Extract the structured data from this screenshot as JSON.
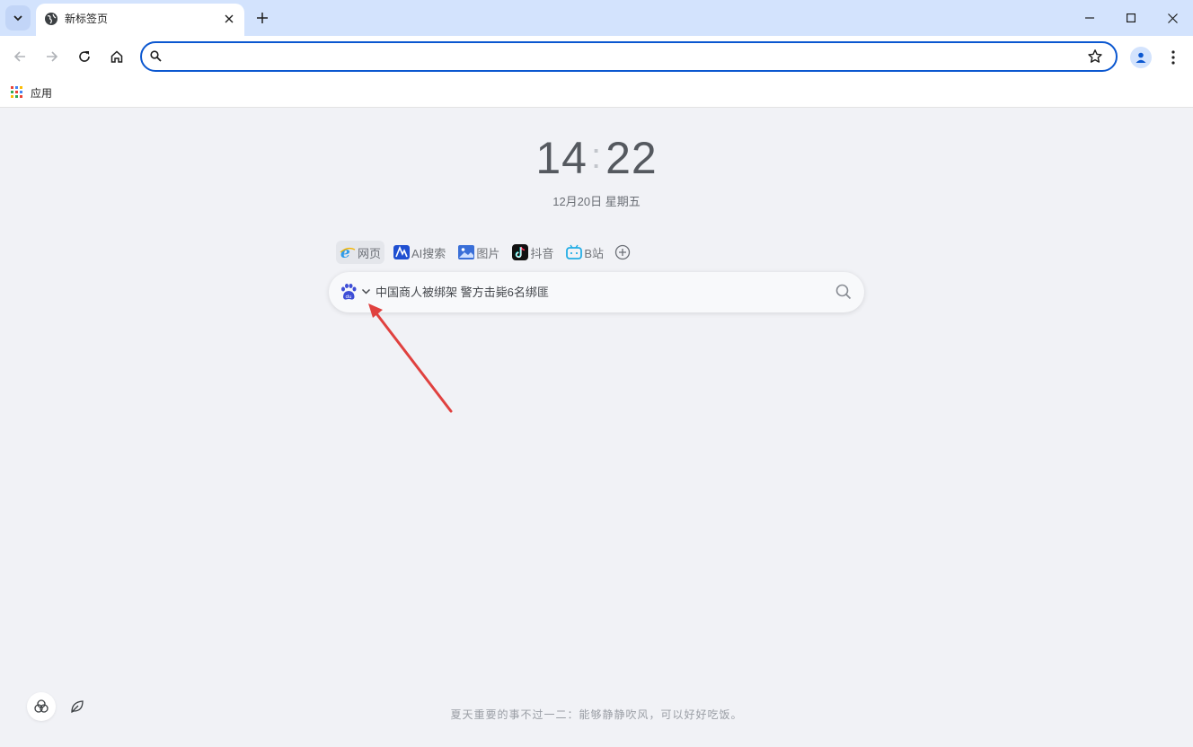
{
  "tab": {
    "title": "新标签页"
  },
  "omnibox": {
    "value": "",
    "placeholder": ""
  },
  "bookmarks": {
    "apps_label": "应用"
  },
  "clock": {
    "hours": "14",
    "separator": ":",
    "minutes": "22"
  },
  "date": {
    "text": "12月20日 星期五"
  },
  "engines": [
    {
      "label": "网页",
      "icon": "ie-icon",
      "active": true
    },
    {
      "label": "AI搜索",
      "icon": "ai-search-icon"
    },
    {
      "label": "图片",
      "icon": "image-icon"
    },
    {
      "label": "抖音",
      "icon": "douyin-icon"
    },
    {
      "label": "B站",
      "icon": "bilibili-icon"
    }
  ],
  "search": {
    "placeholder": "中国商人被绑架 警方击毙6名绑匪",
    "engine_icon": "baidu-paw-icon"
  },
  "quote": {
    "text": "夏天重要的事不过一二：能够静静吹风，可以好好吃饭。"
  },
  "colors": {
    "accent": "#0b57d0",
    "tabstrip": "#d3e3fd",
    "page_bg": "#f1f2f6",
    "arrow": "#e0413f"
  }
}
